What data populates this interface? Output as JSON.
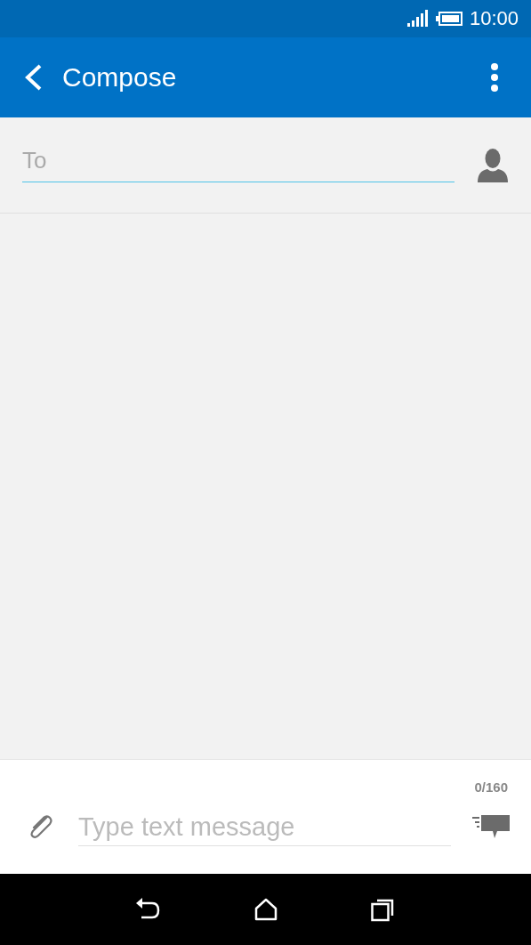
{
  "status_bar": {
    "time": "10:00"
  },
  "app_bar": {
    "title": "Compose"
  },
  "recipient": {
    "placeholder": "To",
    "focused": true
  },
  "composer": {
    "counter": "0/160",
    "placeholder": "Type text message"
  }
}
